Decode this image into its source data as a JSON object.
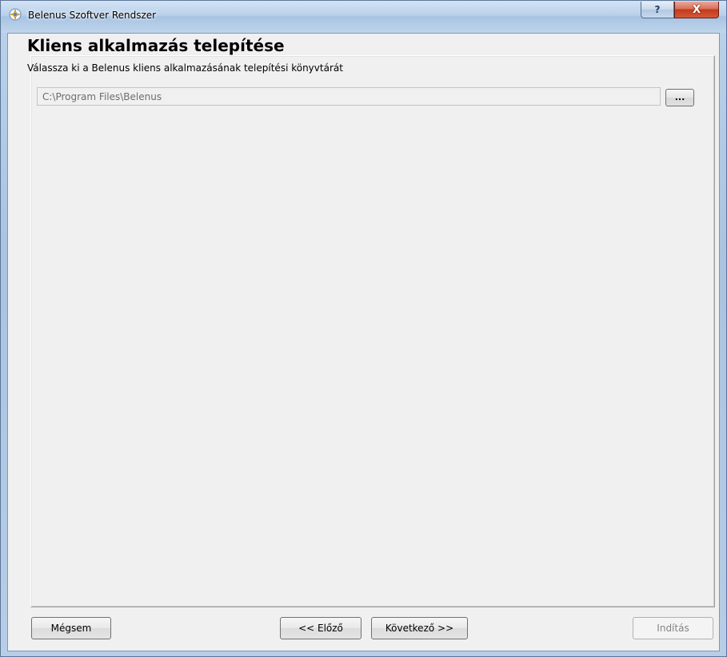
{
  "window": {
    "title": "Belenus Szoftver Rendszer",
    "help_glyph": "?",
    "close_glyph": "X"
  },
  "page": {
    "heading": "Kliens alkalmazás telepítése",
    "subtitle": "Válassza ki a Belenus kliens alkalmazásának telepítési könyvtárát",
    "path_value": "C:\\Program Files\\Belenus",
    "browse_label": "..."
  },
  "buttons": {
    "cancel": "Mégsem",
    "back": "<< Előző",
    "next": "Következő >>",
    "start": "Indítás"
  },
  "icons": {
    "app": "belenus-app-icon",
    "help": "help-icon",
    "close": "close-icon"
  }
}
